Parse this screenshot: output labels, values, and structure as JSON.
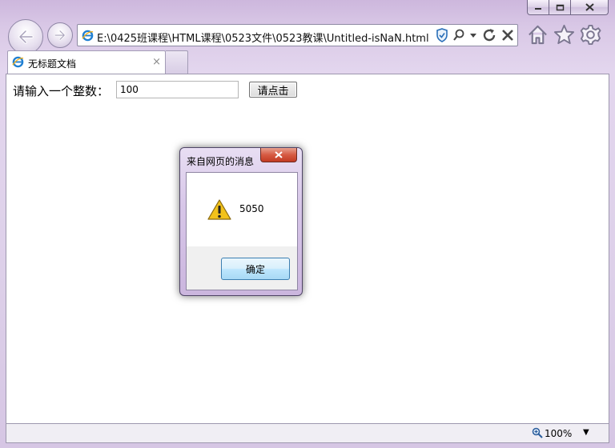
{
  "window": {
    "caption_buttons": [
      "minimize-icon",
      "maximize-icon",
      "close-icon"
    ]
  },
  "navigation": {
    "address": "E:\\0425班课程\\HTML课程\\0523文件\\0523教课\\Untitled-isNaN.html",
    "page_icon": "ie-page-icon",
    "address_icons": [
      "shield-icon",
      "search-icon",
      "dropdown-arrow-icon",
      "refresh-icon",
      "stop-icon"
    ],
    "tool_icons": [
      "home-icon",
      "favorites-star-icon",
      "gear-icon"
    ]
  },
  "tab": {
    "title": "无标题文档",
    "close_glyph": "×"
  },
  "page": {
    "label": "请输入一个整数：",
    "input_value": "100",
    "button_label": "请点击"
  },
  "dialog": {
    "title": "来自网页的消息",
    "message": "5050",
    "ok_label": "确定",
    "icon": "warning-icon"
  },
  "statusbar": {
    "zoom": "100%",
    "zoom_arrow": "▼"
  },
  "colors": {
    "frame": "#d9c8e6",
    "dialog_close": "#c8432a",
    "ok_button_border": "#3c7fb1",
    "warning": "#f2c21b"
  }
}
